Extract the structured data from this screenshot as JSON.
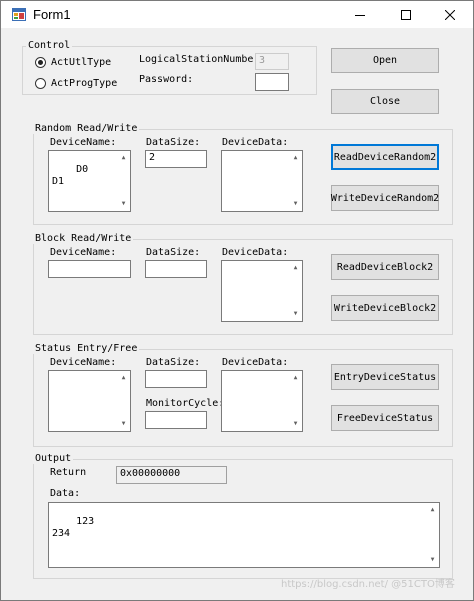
{
  "window": {
    "title": "Form1",
    "icons": {
      "app": "form-app-icon",
      "minimize": "minimize-icon",
      "maximize": "maximize-icon",
      "close": "close-icon"
    }
  },
  "control": {
    "title": "Control",
    "radio_utl": "ActUtlType",
    "radio_prog": "ActProgType",
    "selected": "ActUtlType",
    "station_label": "LogicalStationNumbe",
    "station_value": "3",
    "password_label": "Password:",
    "password_value": ""
  },
  "buttons": {
    "open": "Open",
    "close": "Close",
    "read_random": "ReadDeviceRandom2",
    "write_random": "WriteDeviceRandom2",
    "read_block": "ReadDeviceBlock2",
    "write_block": "WriteDeviceBlock2",
    "entry_status": "EntryDeviceStatus",
    "free_status": "FreeDeviceStatus"
  },
  "random": {
    "title": "Random Read/Write",
    "devicename_label": "DeviceName:",
    "devicename_value": "D0\nD1",
    "datasize_label": "DataSize:",
    "datasize_value": "2",
    "devicedata_label": "DeviceData:",
    "devicedata_value": ""
  },
  "block": {
    "title": "Block Read/Write",
    "devicename_label": "DeviceName:",
    "devicename_value": "",
    "datasize_label": "DataSize:",
    "datasize_value": "",
    "devicedata_label": "DeviceData:",
    "devicedata_value": ""
  },
  "status": {
    "title": "Status Entry/Free",
    "devicename_label": "DeviceName:",
    "devicename_value": "",
    "datasize_label": "DataSize:",
    "datasize_value": "",
    "monitorcycle_label": "MonitorCycle:",
    "monitorcycle_value": "",
    "devicedata_label": "DeviceData:",
    "devicedata_value": ""
  },
  "output": {
    "title": "Output",
    "return_label": "Return",
    "return_value": "0x00000000",
    "data_label": "Data:",
    "data_value": "123\n234"
  },
  "watermark": "https://blog.csdn.net/ @51CTO博客"
}
